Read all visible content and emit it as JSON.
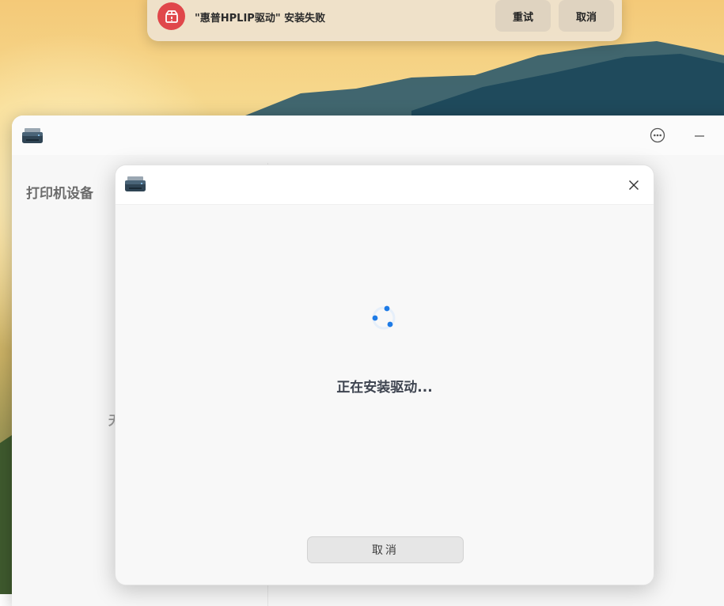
{
  "notification": {
    "message": "\"惠普HPLIP驱动\" 安装失败",
    "retry_label": "重试",
    "cancel_label": "取消",
    "icon": "package-error-icon",
    "icon_color": "#e0474a"
  },
  "main_window": {
    "sidebar_title": "打印机设备",
    "partial_text": "无",
    "app_icon": "printer-icon",
    "more_icon": "more-options-icon",
    "minimize_icon": "minimize-icon"
  },
  "dialog": {
    "app_icon": "printer-icon",
    "close_icon": "close-icon",
    "status_text": "正在安装驱动...",
    "cancel_label": "取消",
    "spinner_color": "#1e7be6"
  }
}
